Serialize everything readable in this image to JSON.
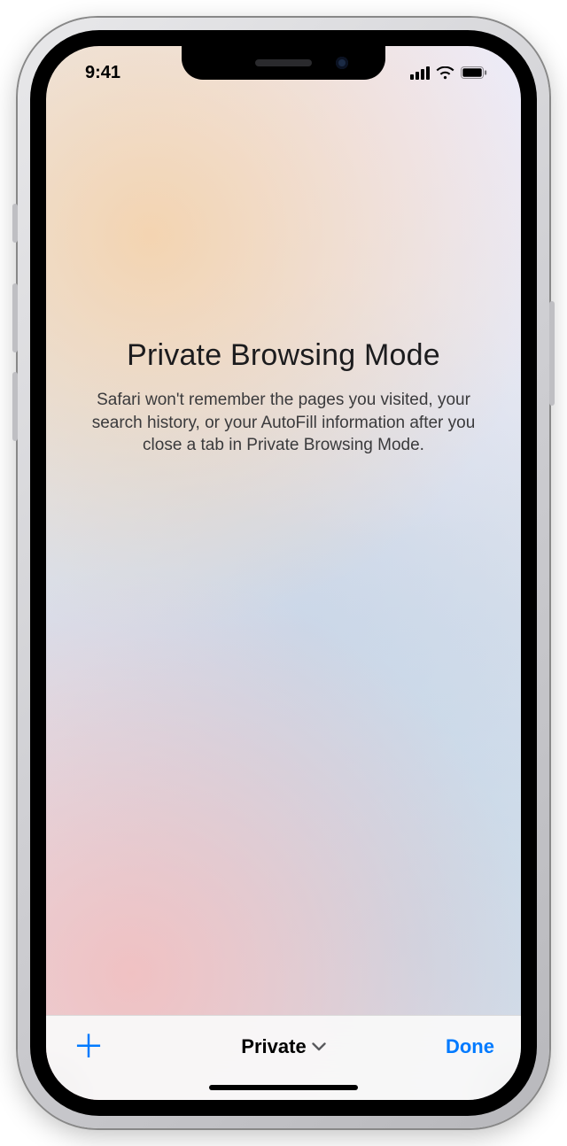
{
  "status": {
    "time": "9:41"
  },
  "main": {
    "title": "Private Browsing Mode",
    "description": "Safari won't remember the pages you visited, your search history, or your AutoFill information after you close a tab in Private Browsing Mode."
  },
  "toolbar": {
    "group_label": "Private",
    "done_label": "Done"
  }
}
